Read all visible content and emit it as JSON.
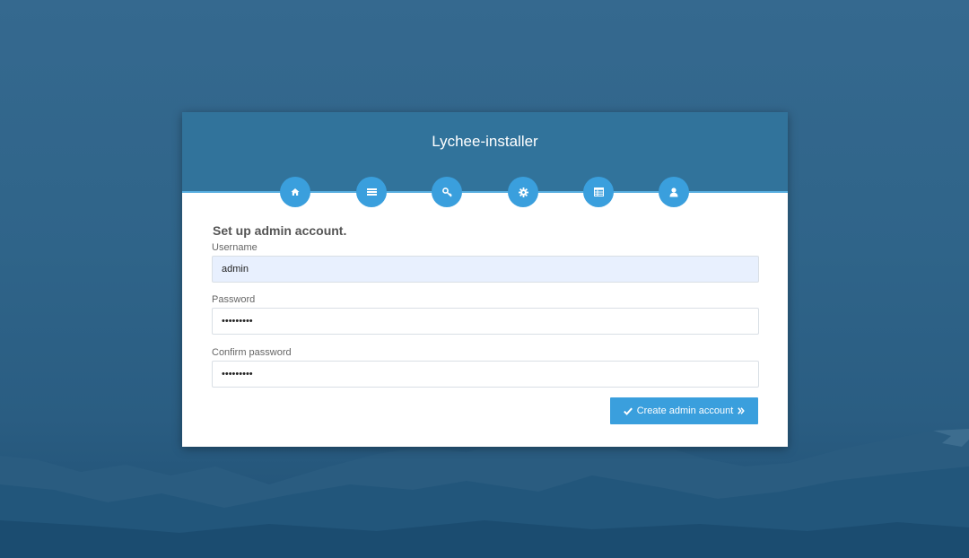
{
  "installer": {
    "title": "Lychee-installer",
    "steps": [
      {
        "icon": "home-icon"
      },
      {
        "icon": "list-icon"
      },
      {
        "icon": "key-icon"
      },
      {
        "icon": "gear-icon"
      },
      {
        "icon": "table-icon"
      },
      {
        "icon": "user-icon"
      }
    ]
  },
  "form": {
    "heading": "Set up admin account.",
    "username_label": "Username",
    "username_value": "admin",
    "password_label": "Password",
    "password_value": "password1",
    "confirm_label": "Confirm password",
    "confirm_value": "password1",
    "submit_label": "Create admin account"
  },
  "colors": {
    "header_bg": "#31739b",
    "accent": "#3a9fdd",
    "background": "#2f6489",
    "autofill_bg": "#e8f0fe"
  }
}
